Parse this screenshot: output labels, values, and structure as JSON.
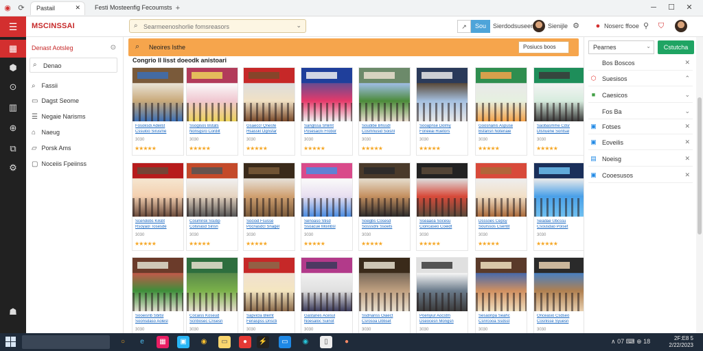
{
  "browser": {
    "tabs": [
      {
        "label": "Pastail",
        "active": true
      },
      {
        "label": "Festi Mosteenfig Fecoumsts",
        "active": false
      }
    ],
    "new_tab": "+",
    "controls": {
      "minimize": "─",
      "restore": "☐",
      "close": "✕"
    }
  },
  "header": {
    "brand": "MSCINSSAI",
    "search_placeholder": "Searmeenoshorlie fomsreasors",
    "button_label": "Sou",
    "user_label": "Sierdodsuseenoe",
    "profile_label": "Sienijle",
    "account_label": "Noserc ffooe"
  },
  "rail": {
    "items": [
      "logo",
      "grid",
      "cube",
      "compass",
      "building",
      "globe",
      "layers",
      "gear"
    ],
    "bottom": "android"
  },
  "leftnav": {
    "title": "Denast Aotsleg",
    "close": "⊙",
    "search_label": "Denao",
    "items": [
      {
        "icon": "search-icon",
        "label": "Fassii"
      },
      {
        "icon": "doc-icon",
        "label": "Dagst Seome"
      },
      {
        "icon": "list-icon",
        "label": "Negaie Narisms"
      },
      {
        "icon": "tag-icon",
        "label": "Naeug"
      },
      {
        "icon": "folder-icon",
        "label": "Porsk Ams"
      },
      {
        "icon": "card-icon",
        "label": "Noceiis Fpeiinss"
      }
    ]
  },
  "main": {
    "bar_label": "Neoires Isthe",
    "sort_label": "Posiucs boos",
    "section_title": "Congrio Il Iisst doeodk anistoari",
    "cards": [
      {
        "title": "Fosoksdi Adeilst",
        "title2": "Cssuloo Sirusme",
        "meta": "3030",
        "stars": "★★★★★"
      },
      {
        "title": "Ssogisos Bstats",
        "title2": "Nonsgsro Cordilt",
        "meta": "3030",
        "stars": "★★★★★"
      },
      {
        "title": "Gsaeccr Qnesfe",
        "title2": "Hsasskl Ognsfar",
        "meta": "3030",
        "stars": "★★★★★"
      },
      {
        "title": "Sanglssa Shlimt",
        "title2": "Posesacni Frobor",
        "meta": "3030",
        "stars": "★★★★★"
      },
      {
        "title": "Soudibe Bhssdl",
        "title2": "Cosmnusid Soisnl",
        "meta": "3030",
        "stars": "★★★★★"
      },
      {
        "title": "Sooapnse Dolmy",
        "title2": "Foneeai Ruetors",
        "meta": "3030",
        "stars": "★★★★★"
      },
      {
        "title": "Goosnanis Aspuse",
        "title2": "Bsfansn Notenaie",
        "meta": "3030",
        "stars": "★★★★★"
      },
      {
        "title": "Saobasmme Cdsr",
        "title2": "Dlsnuene Sontsal",
        "meta": "3030",
        "stars": "★★★★★"
      },
      {
        "title": "Scendobs Kilsbt",
        "title2": "Rsoyaol Tosesde",
        "meta": "3030",
        "stars": "★★★★★"
      },
      {
        "title": "Cosimnsk Ssutip",
        "title2": "Colsnasd Sinsn",
        "meta": "3030",
        "stars": "★★★★★"
      },
      {
        "title": "Sociod Fsusse",
        "title2": "Pocnasdcl Snagel",
        "meta": "3030",
        "stars": "★★★★★"
      },
      {
        "title": "Senoaso Stisd",
        "title2": "Ssoacue Moinbsl",
        "meta": "3030",
        "stars": "★★★★★"
      },
      {
        "title": "Soegbs Cosesd",
        "title2": "Sosssdni Ssoets",
        "meta": "3030",
        "stars": "★★★★★"
      },
      {
        "title": "Sseaaoa Socesu",
        "title2": "Cioncaseo Coeidt",
        "meta": "3030",
        "stars": "★★★★★"
      },
      {
        "title": "Dsssoes Cepsy",
        "title2": "Sourssos Csentit",
        "meta": "3030",
        "stars": "★★★★★"
      },
      {
        "title": "Seadae Ubcssu",
        "title2": "Csousdao Poiset",
        "meta": "3030",
        "stars": "★★★★★"
      },
      {
        "title": "Sooeisnb Sbitsl",
        "title2": "Soonsdaso Aolesl",
        "meta": "3030",
        "stars": "★★★★★"
      },
      {
        "title": "Cocaiss Koseud",
        "title2": "Scnbosec Cnsesn",
        "meta": "3030",
        "stars": "★★★★★"
      },
      {
        "title": "Sapvicla Blemt",
        "title2": "Fenaspss Dnscti",
        "meta": "3030",
        "stars": "★★★★★"
      },
      {
        "title": "Gastanes Acesul",
        "title2": "Noesaloc Suinot",
        "meta": "3030",
        "stars": "★★★★★"
      },
      {
        "title": "Ssdnanss Oiaect",
        "title2": "Csrosoa Dbtiset",
        "meta": "3030",
        "stars": "★★★★★"
      },
      {
        "title": "Poenyiur Aocstm",
        "title2": "Dseocesn Mongsn",
        "meta": "3030",
        "stars": "★★★★★"
      },
      {
        "title": "Sesaonpa Seahc",
        "title2": "Csnrcooa Ssdsst",
        "meta": "3030",
        "stars": "★★★★★"
      },
      {
        "title": "Onceasio Csdseo",
        "title2": "Cosnlsse Syuesn",
        "meta": "3030",
        "stars": "★★★★★"
      }
    ]
  },
  "rightpanel": {
    "select_label": "Pearnes",
    "button_label": "Cstutcha",
    "rows": [
      {
        "icon": "",
        "label": "Bos Boscos",
        "action": "✕",
        "color": "#555"
      },
      {
        "icon": "⬡",
        "label": "Suesisos",
        "action": "⌃",
        "color": "#e53935"
      },
      {
        "icon": "■",
        "label": "Caesicos",
        "action": "⌄",
        "color": "#43a047"
      },
      {
        "icon": "",
        "label": "Fos Ba",
        "action": "⌄",
        "color": "#555"
      },
      {
        "icon": "▣",
        "label": "Fotses",
        "action": "✕",
        "color": "#1e88e5"
      },
      {
        "icon": "▣",
        "label": "Eoveilis",
        "action": "✕",
        "color": "#1e88e5"
      },
      {
        "icon": "▤",
        "label": "Noeisg",
        "action": "✕",
        "color": "#1e88e5"
      },
      {
        "icon": "▣",
        "label": "Cooesusos",
        "action": "✕",
        "color": "#1e88e5"
      }
    ]
  },
  "taskbar": {
    "tray": "∧ 07 ⌨ ⊕ 18",
    "time": "2F:E8 5",
    "date": "2/22/2023"
  },
  "colors": {
    "brand": "#d32f2f",
    "accent_orange": "#f6a54c",
    "accent_green": "#1fa463",
    "link_blue": "#1565c0",
    "star_gold": "#f5a623"
  }
}
